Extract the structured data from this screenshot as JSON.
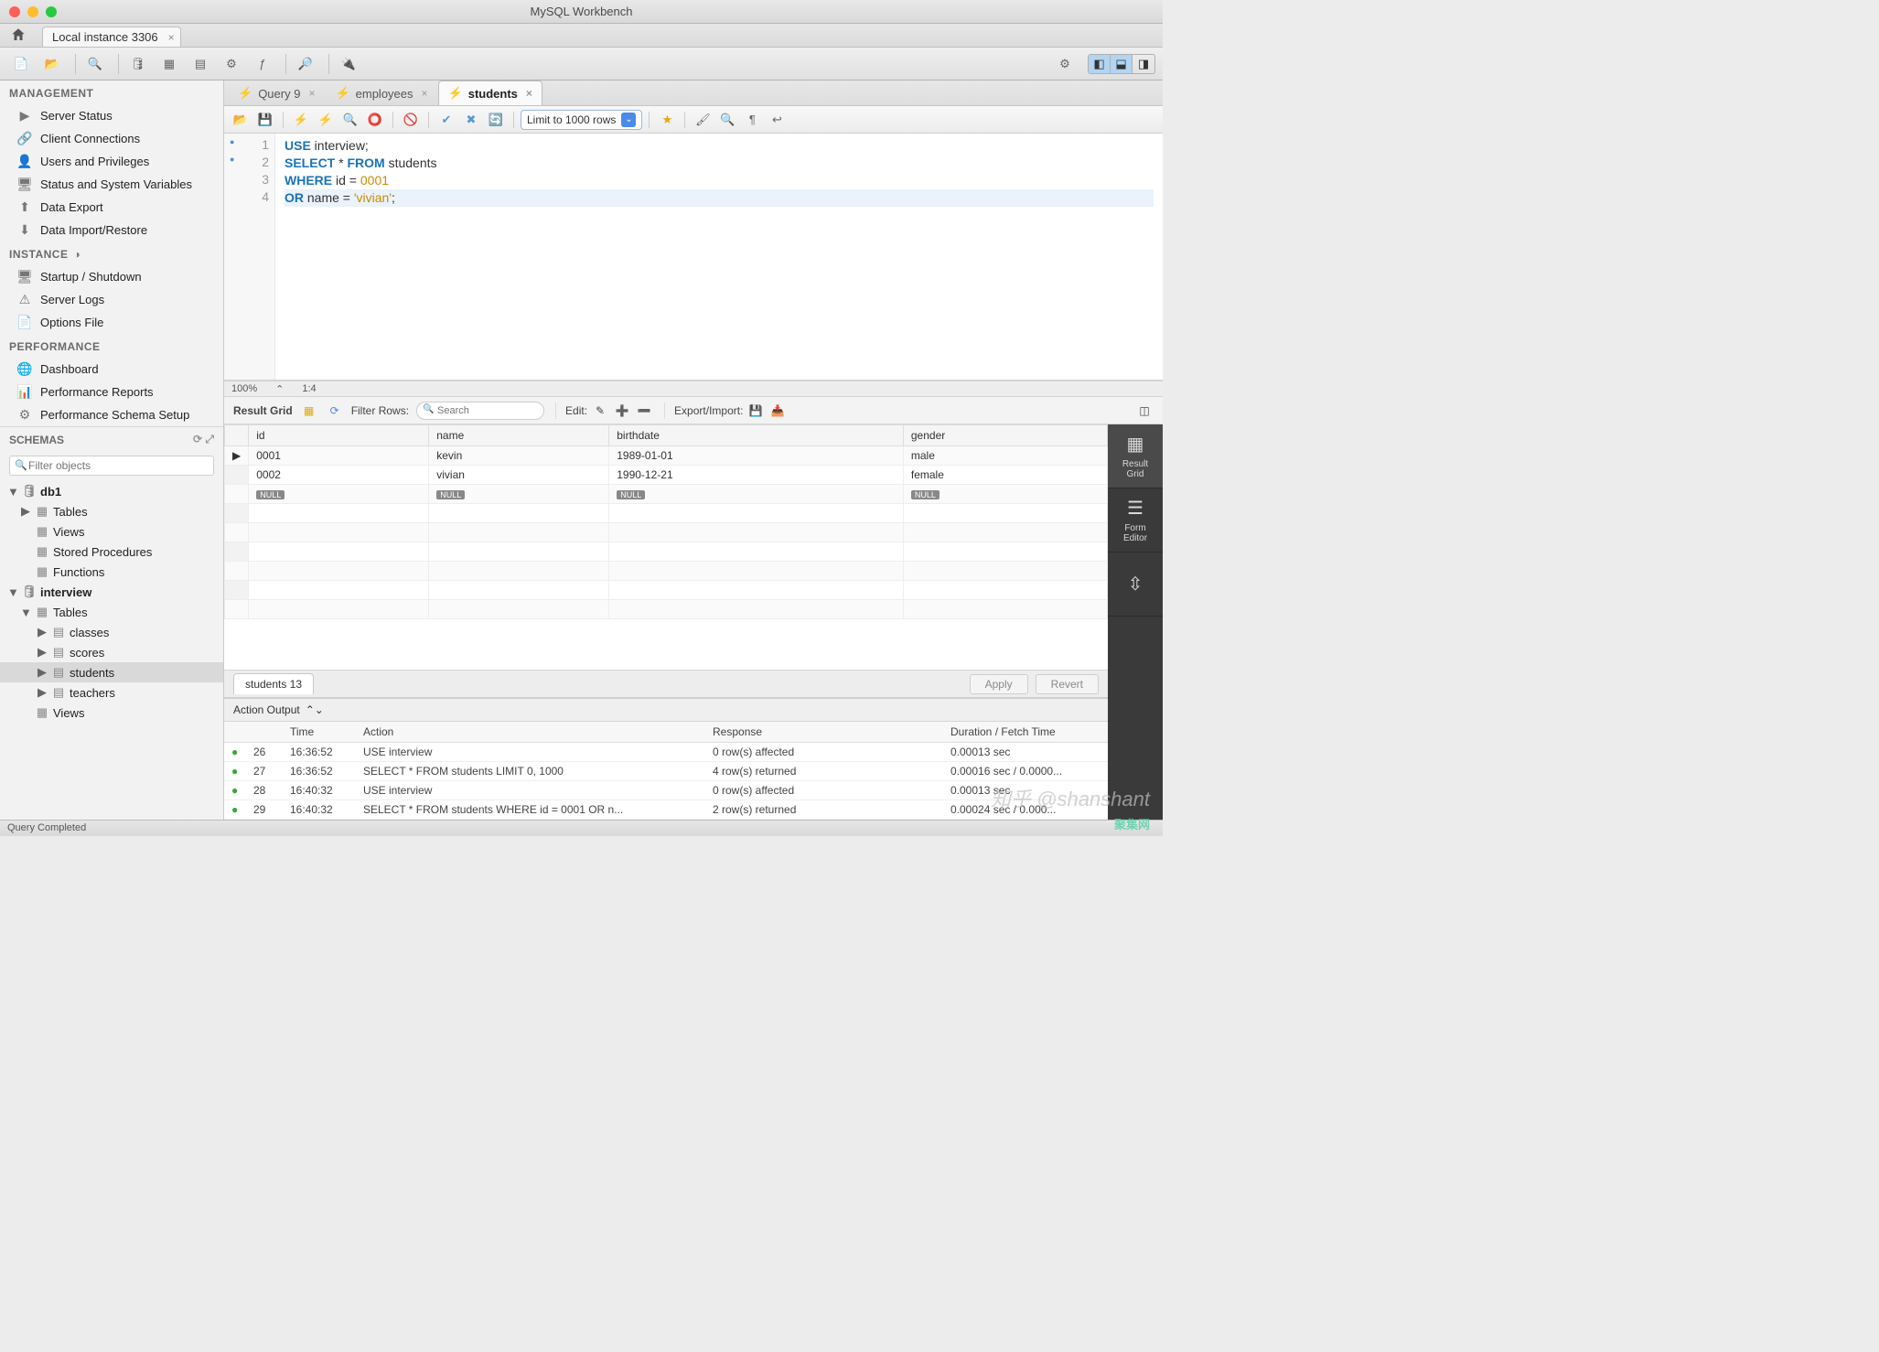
{
  "window": {
    "title": "MySQL Workbench",
    "status": "Query Completed"
  },
  "conn_tab": {
    "label": "Local instance 3306"
  },
  "sidebar": {
    "management_hdr": "MANAGEMENT",
    "management": [
      {
        "label": "Server Status"
      },
      {
        "label": "Client Connections"
      },
      {
        "label": "Users and Privileges"
      },
      {
        "label": "Status and System Variables"
      },
      {
        "label": "Data Export"
      },
      {
        "label": "Data Import/Restore"
      }
    ],
    "instance_hdr": "INSTANCE",
    "instance": [
      {
        "label": "Startup / Shutdown"
      },
      {
        "label": "Server Logs"
      },
      {
        "label": "Options File"
      }
    ],
    "performance_hdr": "PERFORMANCE",
    "performance": [
      {
        "label": "Dashboard"
      },
      {
        "label": "Performance Reports"
      },
      {
        "label": "Performance Schema Setup"
      }
    ],
    "schemas_hdr": "SCHEMAS",
    "filter_ph": "Filter objects",
    "tree": {
      "db1": {
        "name": "db1",
        "tables": "Tables",
        "views": "Views",
        "sp": "Stored Procedures",
        "fn": "Functions"
      },
      "interview": {
        "name": "interview",
        "tables": "Tables",
        "items": [
          "classes",
          "scores",
          "students",
          "teachers"
        ],
        "views": "Views"
      }
    }
  },
  "editor": {
    "tabs": [
      {
        "label": "Query 9",
        "active": false
      },
      {
        "label": "employees",
        "active": false
      },
      {
        "label": "students",
        "active": true
      }
    ],
    "limit": "Limit to 1000 rows",
    "zoom": "100%",
    "cursor": "1:4",
    "lines": [
      {
        "n": 1,
        "dot": true,
        "html": "<span class='kw'>USE</span> interview;"
      },
      {
        "n": 2,
        "dot": true,
        "html": "<span class='kw'>SELECT</span> * <span class='kw'>FROM</span> students"
      },
      {
        "n": 3,
        "dot": false,
        "html": "<span class='kw'>WHERE</span> id = <span class='num'>0001</span>"
      },
      {
        "n": 4,
        "dot": false,
        "html": "<span class='kw'>OR</span> name = <span class='str'>'vivian'</span>;"
      }
    ]
  },
  "result": {
    "toolbar": {
      "grid_lbl": "Result Grid",
      "filter_lbl": "Filter Rows:",
      "search_ph": "Search",
      "edit_lbl": "Edit:",
      "export_lbl": "Export/Import:"
    },
    "columns": [
      "id",
      "name",
      "birthdate",
      "gender"
    ],
    "rows": [
      [
        "0001",
        "kevin",
        "1989-01-01",
        "male"
      ],
      [
        "0002",
        "vivian",
        "1990-12-21",
        "female"
      ]
    ],
    "tab_label": "students 13",
    "apply": "Apply",
    "revert": "Revert",
    "side": {
      "grid": "Result\nGrid",
      "form": "Form\nEditor"
    }
  },
  "output": {
    "hdr": "Action Output",
    "cols": {
      "n": "",
      "time": "Time",
      "action": "Action",
      "response": "Response",
      "duration": "Duration / Fetch Time"
    },
    "rows": [
      {
        "n": "26",
        "time": "16:36:52",
        "action": "USE interview",
        "response": "0 row(s) affected",
        "duration": "0.00013 sec"
      },
      {
        "n": "27",
        "time": "16:36:52",
        "action": "SELECT * FROM students LIMIT 0, 1000",
        "response": "4 row(s) returned",
        "duration": "0.00016 sec / 0.0000..."
      },
      {
        "n": "28",
        "time": "16:40:32",
        "action": "USE interview",
        "response": "0 row(s) affected",
        "duration": "0.00013 sec"
      },
      {
        "n": "29",
        "time": "16:40:32",
        "action": "SELECT * FROM students WHERE id = 0001  OR n...",
        "response": "2 row(s) returned",
        "duration": "0.00024 sec / 0.000..."
      }
    ]
  },
  "watermark": "知乎 @shanshant",
  "watermark2": "聚集网"
}
